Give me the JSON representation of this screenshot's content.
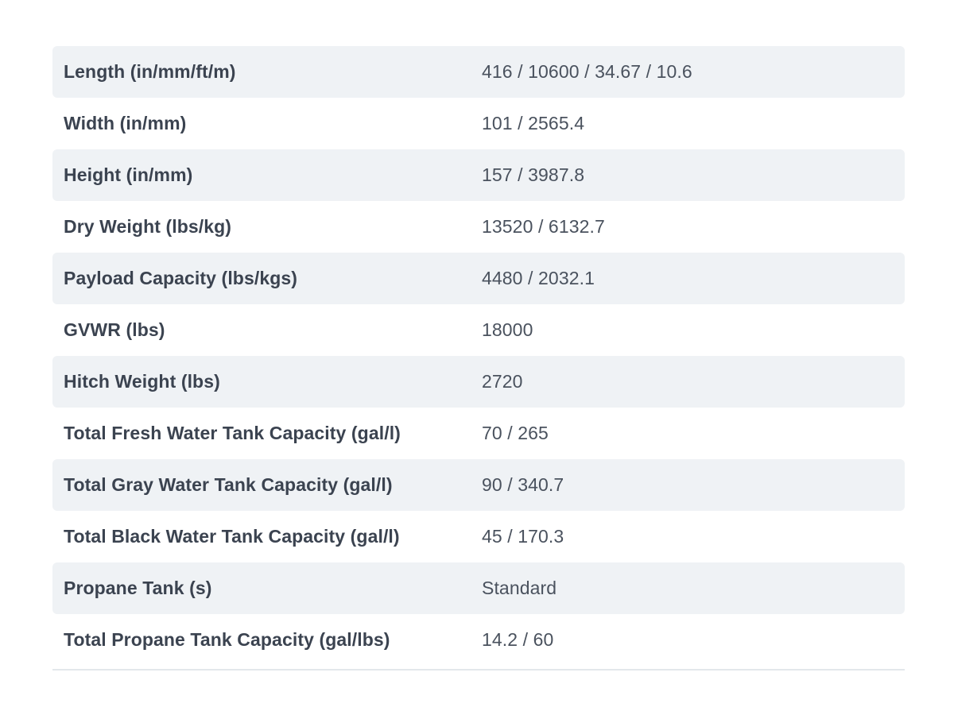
{
  "specs": [
    {
      "label": "Length (in/mm/ft/m)",
      "value": "416 / 10600 / 34.67 / 10.6"
    },
    {
      "label": "Width (in/mm)",
      "value": "101 / 2565.4"
    },
    {
      "label": "Height (in/mm)",
      "value": "157 / 3987.8"
    },
    {
      "label": "Dry Weight (lbs/kg)",
      "value": "13520 / 6132.7"
    },
    {
      "label": "Payload Capacity (lbs/kgs)",
      "value": "4480 / 2032.1"
    },
    {
      "label": "GVWR (lbs)",
      "value": "18000"
    },
    {
      "label": "Hitch Weight (lbs)",
      "value": "2720"
    },
    {
      "label": "Total Fresh Water Tank Capacity (gal/l)",
      "value": "70 / 265"
    },
    {
      "label": "Total Gray Water Tank Capacity (gal/l)",
      "value": "90 / 340.7"
    },
    {
      "label": "Total Black Water Tank Capacity (gal/l)",
      "value": "45 / 170.3"
    },
    {
      "label": "Propane Tank (s)",
      "value": "Standard"
    },
    {
      "label": "Total Propane Tank Capacity (gal/lbs)",
      "value": "14.2 / 60"
    }
  ],
  "colors": {
    "row_shade": "#eff2f5",
    "label_text": "#3b4350",
    "value_text": "#4a525e",
    "rule": "#e3e7eb"
  }
}
